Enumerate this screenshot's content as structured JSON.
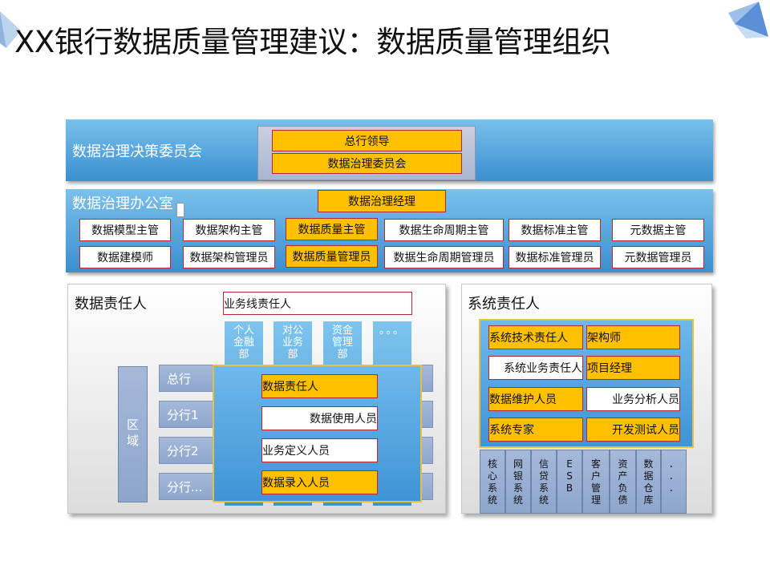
{
  "title": "XX银行数据质量管理建议：数据质量管理组织",
  "committee": {
    "label": "数据治理决策委员会",
    "leader": "总行领导",
    "board": "数据治理委员会"
  },
  "office": {
    "label": "数据治理办公室",
    "manager": "数据治理经理",
    "row1": [
      "数据模型主管",
      "数据架构主管",
      "数据质量主管",
      "数据生命周期主管",
      "数据标准主管",
      "元数据主管"
    ],
    "row2": [
      "数据建模师",
      "数据架构管理员",
      "数据质量管理员",
      "数据生命周期管理员",
      "数据标准管理员",
      "元数据管理员"
    ]
  },
  "data_owner": {
    "label": "数据责任人",
    "line_owner": "业务线责任人",
    "depts": [
      "个人\n金融\n部",
      "对公\n业务\n部",
      "资金\n管理\n部",
      "。。。"
    ],
    "region": "区\n域",
    "rows": [
      "总行",
      "分行1",
      "分行2",
      "分行..."
    ],
    "roles": [
      "数据责任人",
      "数据使用人员",
      "业务定义人员",
      "数据录入人员"
    ]
  },
  "system_owner": {
    "label": "系统责任人",
    "roles": [
      [
        "系统技术责任人",
        "架构师"
      ],
      [
        "系统业务责任人",
        "项目经理"
      ],
      [
        "数据维护人员",
        "业务分析人员"
      ],
      [
        "系统专家",
        "开发测试人员"
      ]
    ],
    "systems": [
      "核\n心\n系\n统",
      "网\n银\n系\n统",
      "信\n贷\n系\n统",
      "E\nS\nB",
      "客\n户\n管\n理",
      "资\n产\n负\n债",
      "数\n据\n仓\n库",
      "．\n．\n．"
    ]
  },
  "colors": {
    "band": "#4a9edb",
    "orange": "#ffc000",
    "border": "#b7282e",
    "row": "#8ea6cc"
  }
}
